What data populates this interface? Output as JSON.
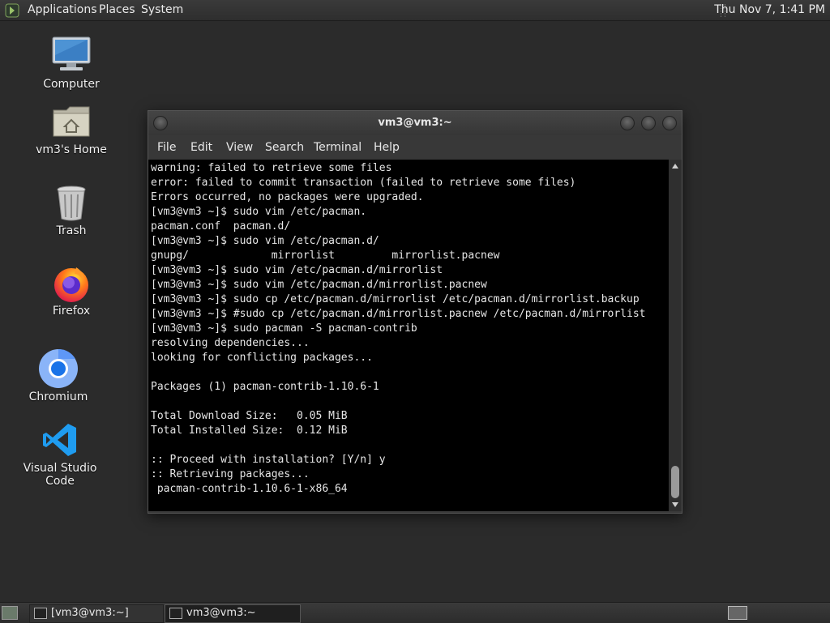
{
  "top_panel": {
    "menus": [
      "Applications",
      "Places",
      "System"
    ],
    "clock": "Thu Nov 7,  1:41 PM"
  },
  "desktop": {
    "icons": [
      {
        "label": "Computer",
        "icon": "computer-icon"
      },
      {
        "label": "vm3's Home",
        "icon": "home-folder-icon"
      },
      {
        "label": "Trash",
        "icon": "trash-icon"
      },
      {
        "label": "Firefox",
        "icon": "firefox-icon"
      },
      {
        "label": "Chromium",
        "icon": "chromium-icon"
      },
      {
        "label": "Visual Studio Code",
        "icon": "vscode-icon"
      }
    ]
  },
  "terminal": {
    "title": "vm3@vm3:~",
    "menu": [
      "File",
      "Edit",
      "View",
      "Search",
      "Terminal",
      "Help"
    ],
    "lines": [
      "warning: failed to retrieve some files",
      "error: failed to commit transaction (failed to retrieve some files)",
      "Errors occurred, no packages were upgraded.",
      "[vm3@vm3 ~]$ sudo vim /etc/pacman.",
      "pacman.conf  pacman.d/",
      "[vm3@vm3 ~]$ sudo vim /etc/pacman.d/",
      "gnupg/             mirrorlist         mirrorlist.pacnew",
      "[vm3@vm3 ~]$ sudo vim /etc/pacman.d/mirrorlist",
      "[vm3@vm3 ~]$ sudo vim /etc/pacman.d/mirrorlist.pacnew",
      "[vm3@vm3 ~]$ sudo cp /etc/pacman.d/mirrorlist /etc/pacman.d/mirrorlist.backup",
      "[vm3@vm3 ~]$ #sudo cp /etc/pacman.d/mirrorlist.pacnew /etc/pacman.d/mirrorlist",
      "[vm3@vm3 ~]$ sudo pacman -S pacman-contrib",
      "resolving dependencies...",
      "looking for conflicting packages...",
      "",
      "Packages (1) pacman-contrib-1.10.6-1",
      "",
      "Total Download Size:   0.05 MiB",
      "Total Installed Size:  0.12 MiB",
      "",
      ":: Proceed with installation? [Y/n] y",
      ":: Retrieving packages...",
      " pacman-contrib-1.10.6-1-x86_64"
    ]
  },
  "taskbar": {
    "tasks": [
      {
        "label": "[vm3@vm3:~]",
        "active": false
      },
      {
        "label": "vm3@vm3:~",
        "active": true
      }
    ]
  }
}
